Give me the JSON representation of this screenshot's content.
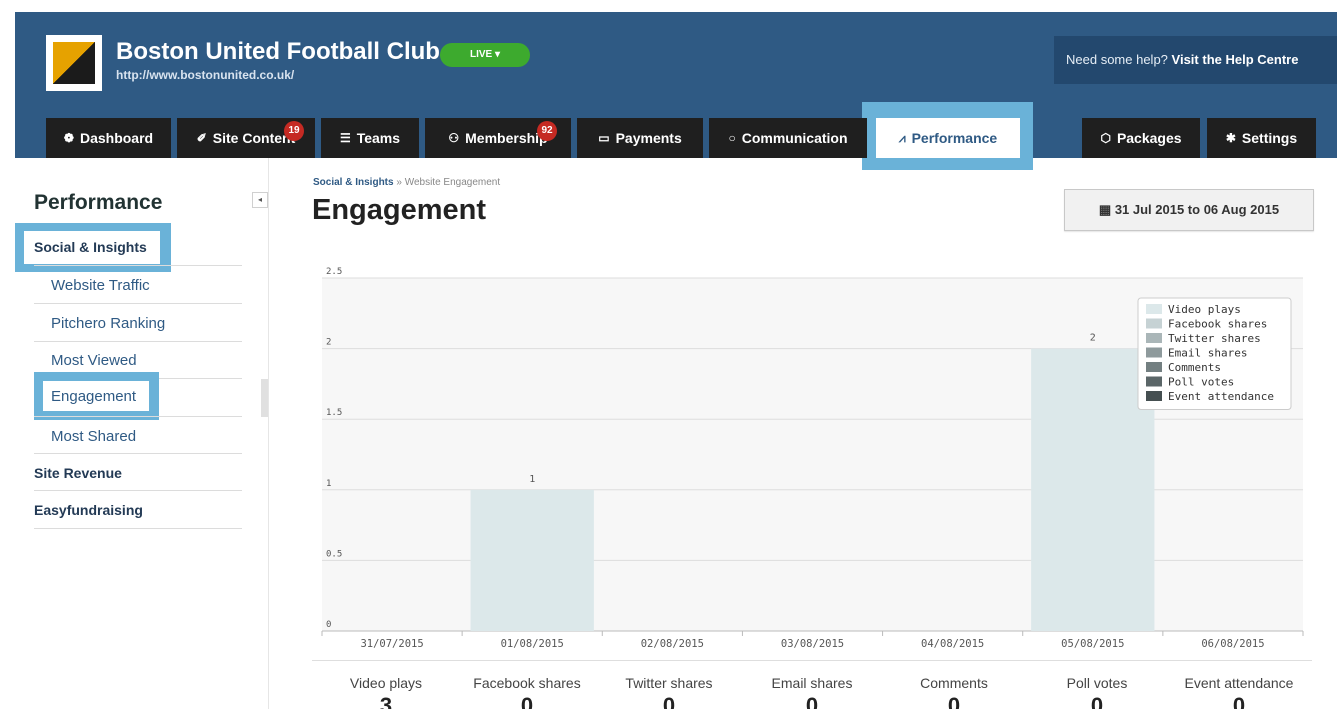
{
  "header": {
    "club_name": "Boston United Football Club",
    "club_url": "http://www.bostonunited.co.uk/",
    "status_label": "LIVE ▾",
    "help_prefix": "Need some help?",
    "help_link": "Visit the Help Centre"
  },
  "tabs": [
    {
      "label": "Dashboard",
      "icon": "dashboard-icon",
      "glyph": "❁"
    },
    {
      "label": "Site Content",
      "icon": "pencil-icon",
      "glyph": "✐",
      "badge": "19"
    },
    {
      "label": "Teams",
      "icon": "list-icon",
      "glyph": "☰"
    },
    {
      "label": "Membership",
      "icon": "users-icon",
      "glyph": "⚇",
      "badge": "92"
    },
    {
      "label": "Payments",
      "icon": "credit-card-icon",
      "glyph": "▭"
    },
    {
      "label": "Communication",
      "icon": "chat-bubble-icon",
      "glyph": "○"
    },
    {
      "label": "Performance",
      "icon": "line-chart-icon",
      "glyph": "⩘"
    },
    {
      "label": "Packages",
      "icon": "package-icon",
      "glyph": "⬡"
    },
    {
      "label": "Settings",
      "icon": "gear-icon",
      "glyph": "✱"
    }
  ],
  "sidebar": {
    "title": "Performance",
    "sections": [
      {
        "label": "Social & Insights"
      },
      {
        "label": "Website Traffic"
      },
      {
        "label": "Pitchero Ranking"
      },
      {
        "label": "Most Viewed"
      },
      {
        "label": "Engagement"
      },
      {
        "label": "Most Shared"
      },
      {
        "label": "Site Revenue"
      },
      {
        "label": "Easyfundraising"
      }
    ],
    "collapse_glyph": "◂"
  },
  "breadcrumb": {
    "parent": "Social & Insights",
    "separator": "»",
    "current": "Website Engagement"
  },
  "page": {
    "title": "Engagement",
    "date_range": "31 Jul 2015 to 06 Aug 2015",
    "date_icon": "calendar-icon"
  },
  "chart_data": {
    "type": "bar",
    "categories": [
      "31/07/2015",
      "01/08/2015",
      "02/08/2015",
      "03/08/2015",
      "04/08/2015",
      "05/08/2015",
      "06/08/2015"
    ],
    "series": [
      {
        "name": "Video plays",
        "color": "#dce8ea",
        "values": [
          0,
          1,
          0,
          0,
          0,
          2,
          0
        ]
      },
      {
        "name": "Facebook shares",
        "color": "#c6d2d4",
        "values": [
          0,
          0,
          0,
          0,
          0,
          0,
          0
        ]
      },
      {
        "name": "Twitter shares",
        "color": "#aab6b8",
        "values": [
          0,
          0,
          0,
          0,
          0,
          0,
          0
        ]
      },
      {
        "name": "Email shares",
        "color": "#8e9a9c",
        "values": [
          0,
          0,
          0,
          0,
          0,
          0,
          0
        ]
      },
      {
        "name": "Comments",
        "color": "#737f81",
        "values": [
          0,
          0,
          0,
          0,
          0,
          0,
          0
        ]
      },
      {
        "name": "Poll votes",
        "color": "#5b6668",
        "values": [
          0,
          0,
          0,
          0,
          0,
          0,
          0
        ]
      },
      {
        "name": "Event attendance",
        "color": "#454f51",
        "values": [
          0,
          0,
          0,
          0,
          0,
          0,
          0
        ]
      }
    ],
    "data_labels": {
      "01/08/2015": "1",
      "05/08/2015": "2"
    },
    "yticks": [
      "0",
      "0.5",
      "1",
      "1.5",
      "2",
      "2.5"
    ],
    "ylim": [
      0,
      2.5
    ],
    "grid": true,
    "legend": "top-right"
  },
  "stats": [
    {
      "label": "Video plays",
      "value": "3"
    },
    {
      "label": "Facebook shares",
      "value": "0"
    },
    {
      "label": "Twitter shares",
      "value": "0"
    },
    {
      "label": "Email shares",
      "value": "0"
    },
    {
      "label": "Comments",
      "value": "0"
    },
    {
      "label": "Poll votes",
      "value": "0"
    },
    {
      "label": "Event attendance",
      "value": "0"
    }
  ]
}
